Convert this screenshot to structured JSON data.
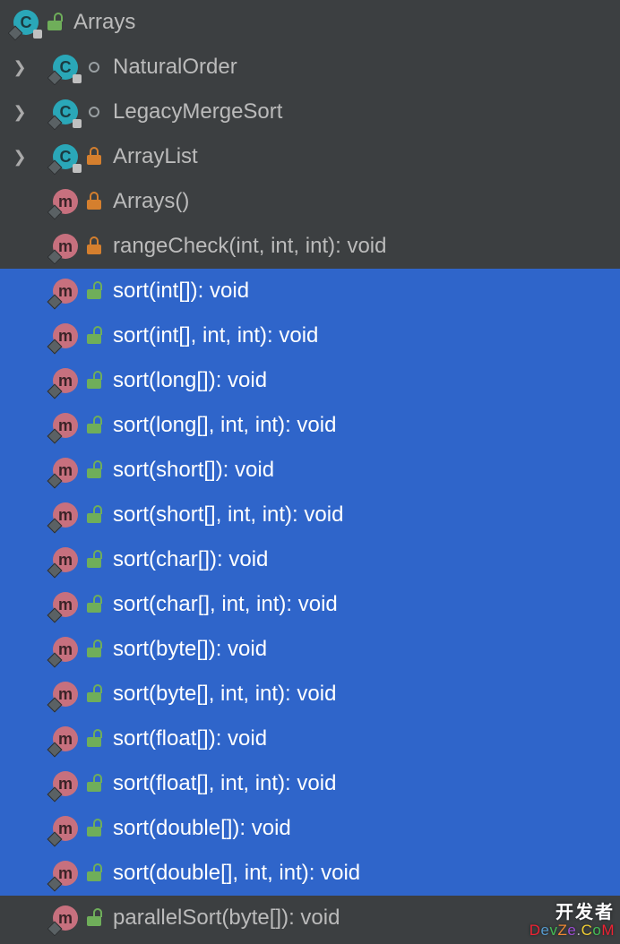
{
  "header": {
    "name": "Arrays",
    "icon": "class",
    "modifier": "public"
  },
  "items": [
    {
      "icon": "class",
      "modifier": "package",
      "label": "NaturalOrder",
      "expandable": true,
      "selected": false
    },
    {
      "icon": "class",
      "modifier": "package",
      "label": "LegacyMergeSort",
      "expandable": true,
      "selected": false
    },
    {
      "icon": "class",
      "modifier": "private",
      "label": "ArrayList",
      "expandable": true,
      "selected": false
    },
    {
      "icon": "method",
      "modifier": "private",
      "label": "Arrays()",
      "expandable": false,
      "selected": false
    },
    {
      "icon": "method",
      "modifier": "private",
      "label": "rangeCheck(int, int, int): void",
      "expandable": false,
      "selected": false
    },
    {
      "icon": "method",
      "modifier": "public",
      "label": "sort(int[]): void",
      "expandable": false,
      "selected": true
    },
    {
      "icon": "method",
      "modifier": "public",
      "label": "sort(int[], int, int): void",
      "expandable": false,
      "selected": true
    },
    {
      "icon": "method",
      "modifier": "public",
      "label": "sort(long[]): void",
      "expandable": false,
      "selected": true
    },
    {
      "icon": "method",
      "modifier": "public",
      "label": "sort(long[], int, int): void",
      "expandable": false,
      "selected": true
    },
    {
      "icon": "method",
      "modifier": "public",
      "label": "sort(short[]): void",
      "expandable": false,
      "selected": true
    },
    {
      "icon": "method",
      "modifier": "public",
      "label": "sort(short[], int, int): void",
      "expandable": false,
      "selected": true
    },
    {
      "icon": "method",
      "modifier": "public",
      "label": "sort(char[]): void",
      "expandable": false,
      "selected": true
    },
    {
      "icon": "method",
      "modifier": "public",
      "label": "sort(char[], int, int): void",
      "expandable": false,
      "selected": true
    },
    {
      "icon": "method",
      "modifier": "public",
      "label": "sort(byte[]): void",
      "expandable": false,
      "selected": true
    },
    {
      "icon": "method",
      "modifier": "public",
      "label": "sort(byte[], int, int): void",
      "expandable": false,
      "selected": true
    },
    {
      "icon": "method",
      "modifier": "public",
      "label": "sort(float[]): void",
      "expandable": false,
      "selected": true
    },
    {
      "icon": "method",
      "modifier": "public",
      "label": "sort(float[], int, int): void",
      "expandable": false,
      "selected": true
    },
    {
      "icon": "method",
      "modifier": "public",
      "label": "sort(double[]): void",
      "expandable": false,
      "selected": true
    },
    {
      "icon": "method",
      "modifier": "public",
      "label": "sort(double[], int, int): void",
      "expandable": false,
      "selected": true
    },
    {
      "icon": "method",
      "modifier": "public",
      "label": "parallelSort(byte[]): void",
      "expandable": false,
      "selected": false
    }
  ],
  "watermark": {
    "line1": "开发者",
    "line2": "DevZe.CoM"
  }
}
